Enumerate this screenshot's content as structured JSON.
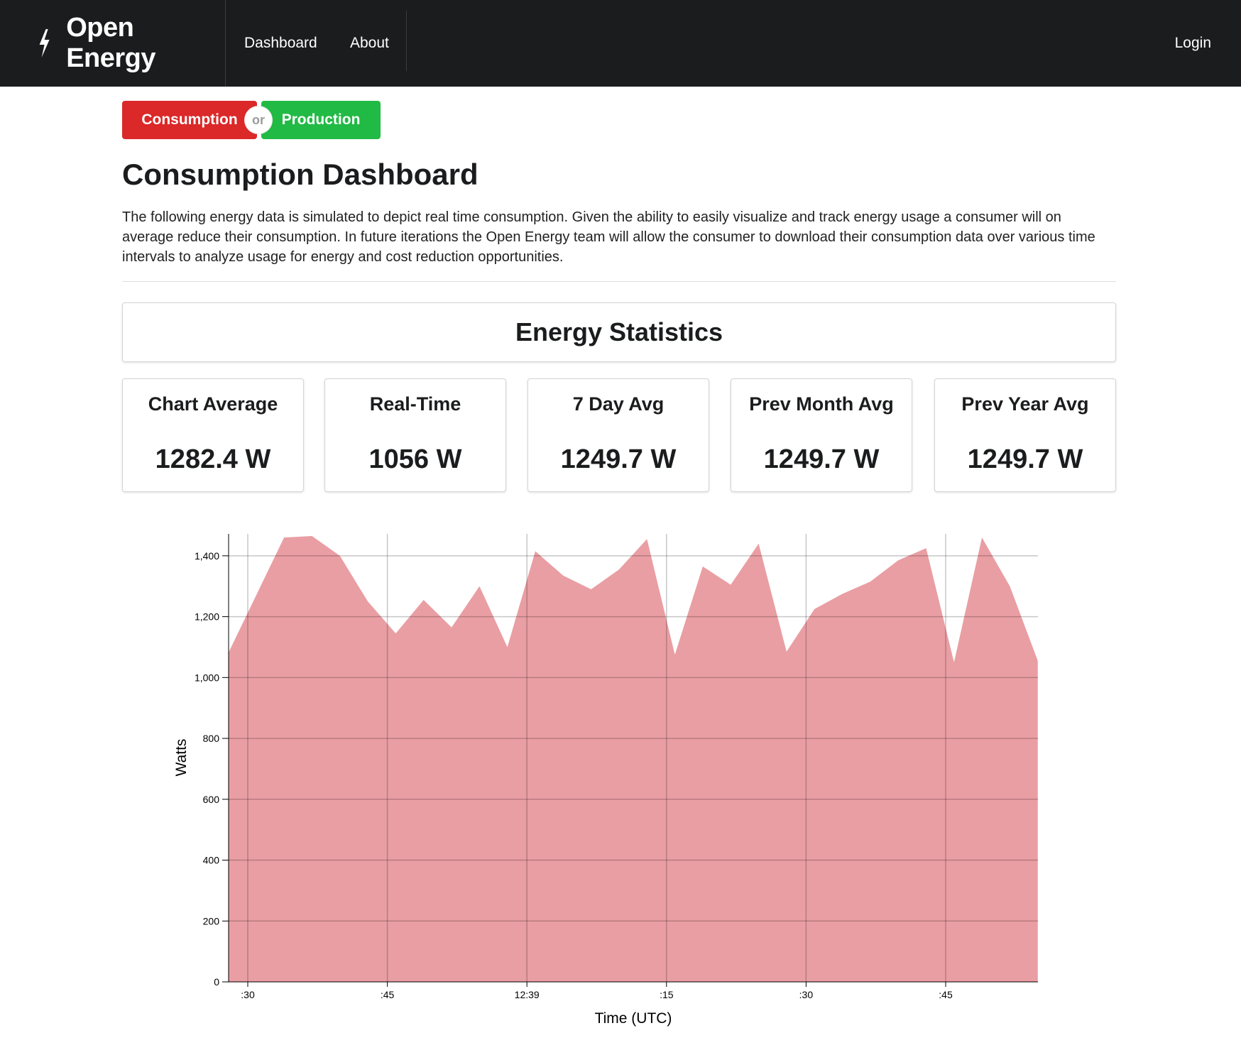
{
  "nav": {
    "brand": "Open Energy",
    "items": [
      "Dashboard",
      "About"
    ],
    "login": "Login"
  },
  "toggle": {
    "consumption": "Consumption",
    "or": "or",
    "production": "Production",
    "colors": {
      "consumption": "#db2828",
      "production": "#21ba45"
    }
  },
  "page": {
    "title": "Consumption Dashboard",
    "intro": "The following energy data is simulated to depict real time consumption. Given the ability to easily visualize and track energy usage a consumer will on average reduce their consumption. In future iterations the Open Energy team will allow the consumer to download their consumption data over various time intervals to analyze usage for energy and cost reduction opportunities."
  },
  "stats": {
    "header": "Energy Statistics",
    "cards": [
      {
        "label": "Chart Average",
        "value": "1282.4 W"
      },
      {
        "label": "Real-Time",
        "value": "1056 W"
      },
      {
        "label": "7 Day Avg",
        "value": "1249.7 W"
      },
      {
        "label": "Prev Month Avg",
        "value": "1249.7 W"
      },
      {
        "label": "Prev Year Avg",
        "value": "1249.7 W"
      }
    ]
  },
  "chart_data": {
    "type": "area",
    "xlabel": "Time (UTC)",
    "ylabel": "Watts",
    "ylim": [
      0,
      1400
    ],
    "yticks": [
      0,
      200,
      400,
      600,
      800,
      1000,
      1200,
      1400
    ],
    "xticks": [
      {
        "label": ":30",
        "min": 0
      },
      {
        "label": ":45",
        "min": 15
      },
      {
        "label": "12:39",
        "min": 30
      },
      {
        "label": ":15",
        "min": 45
      },
      {
        "label": ":30",
        "min": 60
      },
      {
        "label": ":45",
        "min": 75
      }
    ],
    "x_minutes": [
      -2.1,
      0.9,
      3.9,
      6.9,
      9.9,
      12.9,
      15.9,
      18.9,
      21.9,
      24.9,
      27.9,
      30.9,
      33.9,
      36.9,
      39.9,
      42.9,
      45.9,
      48.9,
      51.9,
      54.9,
      57.9,
      60.9,
      63.9,
      66.9,
      69.9,
      72.9,
      75.9,
      78.9,
      81.9,
      84.9
    ],
    "values": [
      1080,
      1270,
      1460,
      1465,
      1400,
      1250,
      1145,
      1255,
      1165,
      1300,
      1100,
      1415,
      1335,
      1290,
      1355,
      1455,
      1075,
      1365,
      1305,
      1440,
      1085,
      1225,
      1275,
      1315,
      1385,
      1425,
      1050,
      1460,
      1300,
      1055
    ],
    "color": "#e99ea3",
    "grid": true
  }
}
